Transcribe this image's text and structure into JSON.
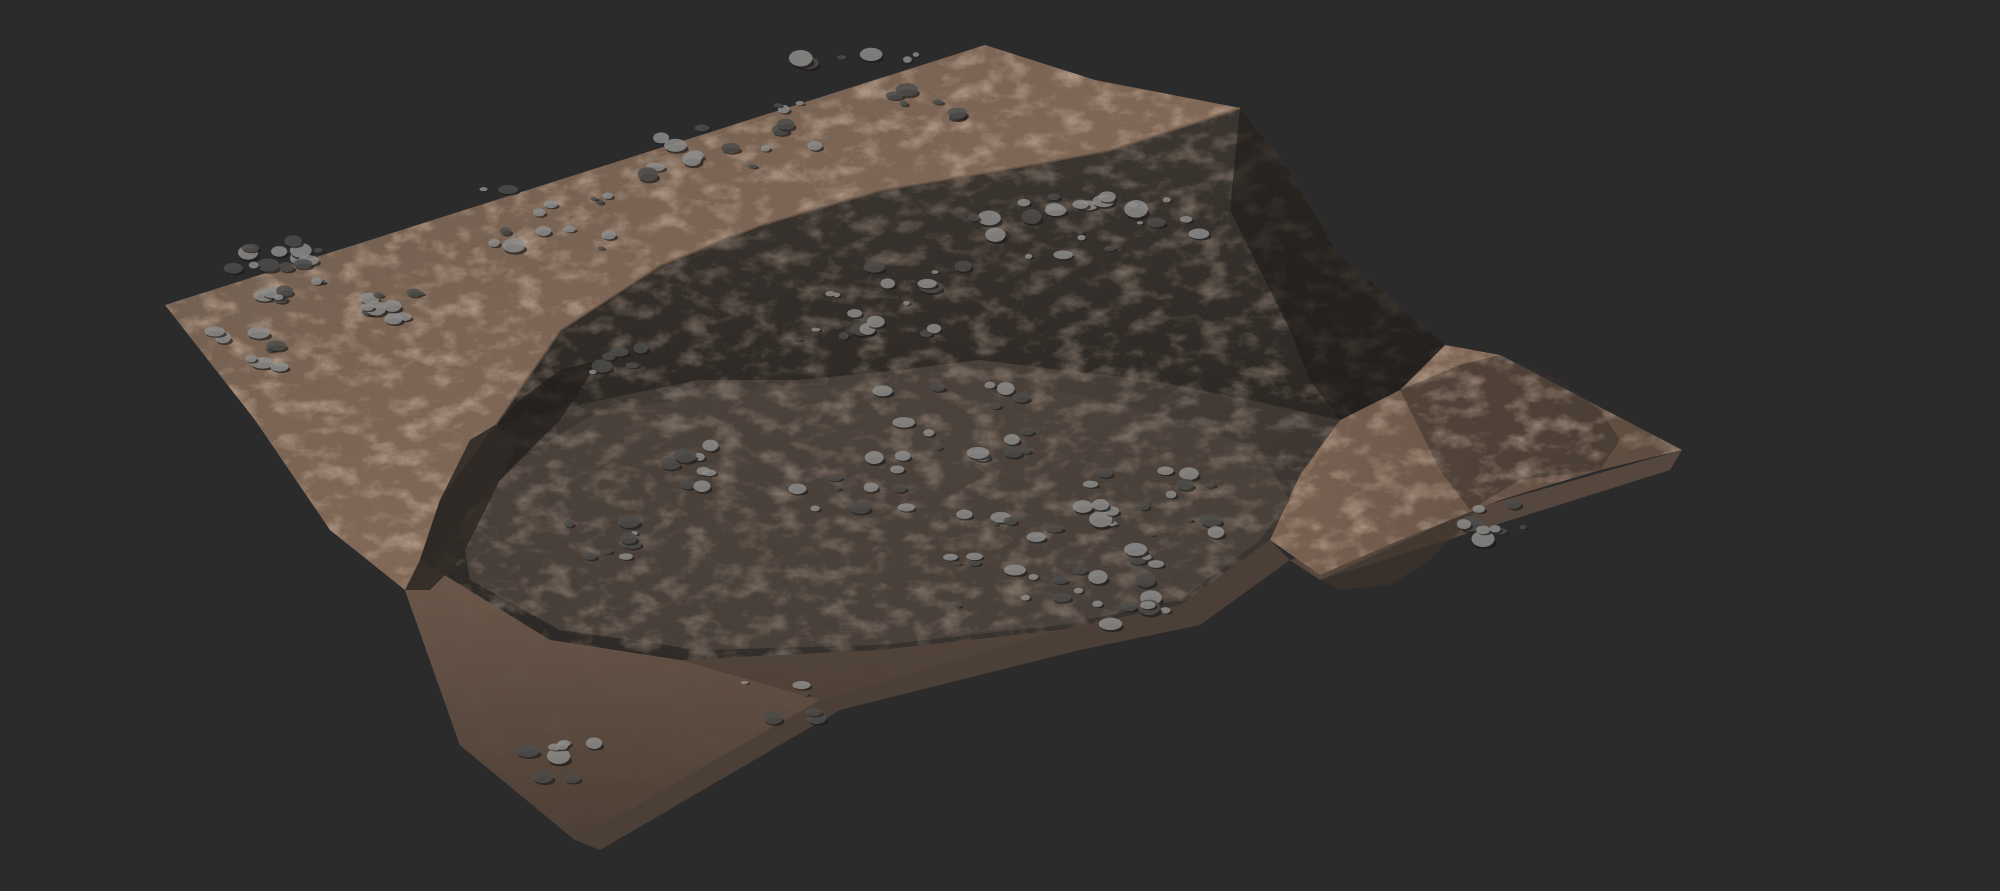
{
  "scene": {
    "background_color": "#2b2b2b",
    "subject": "terrain-mesh",
    "colors": {
      "rock_dark": "#2c2926",
      "rock_mid": "#4a423b",
      "rock_light": "#6d5d50",
      "sand": "#9a7a62",
      "sand_light": "#b48e72",
      "shadow": "#1f1d1b",
      "pebble": "#8d8c8a",
      "pebble_dark": "#4d4c4a"
    }
  }
}
